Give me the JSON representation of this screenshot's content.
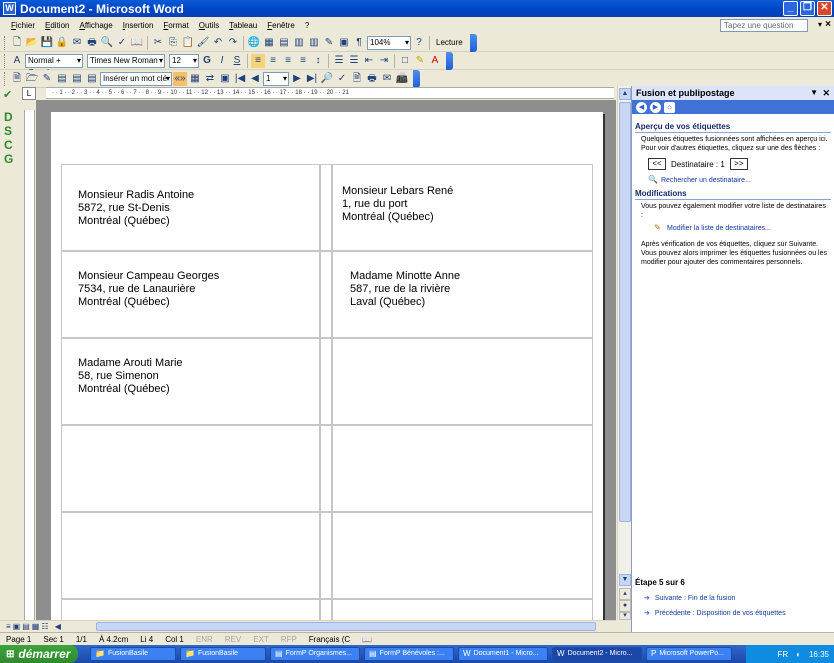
{
  "window": {
    "title": "Document2 - Microsoft Word",
    "minimize": "_",
    "maximize": "❐",
    "close": "✕"
  },
  "menu": {
    "items": [
      "Fichier",
      "Edition",
      "Affichage",
      "Insertion",
      "Format",
      "Outils",
      "Tableau",
      "Fenêtre",
      "?"
    ],
    "help_placeholder": "Tapez une question",
    "close": "×"
  },
  "toolbar_standard": {
    "zoom": "104%",
    "reading": "Lecture"
  },
  "toolbar_format": {
    "style": "Normal + Gauche :",
    "font": "Times New Roman",
    "size": "12",
    "bold": "G",
    "italic": "I",
    "underline": "S"
  },
  "toolbar_merge": {
    "insert_field": "Insérer un mot clé ▾",
    "record": "1"
  },
  "sidebar_letters": [
    "D",
    "S",
    "C",
    "G"
  ],
  "labels": [
    {
      "line1": "Monsieur Radis Antoine",
      "line2": "5872, rue St-Denis",
      "line3": "Montréal (Québec)"
    },
    {
      "line1": "Monsieur Lebars René",
      "line2": "1, rue du port",
      "line3": "Montréal (Québec)"
    },
    {
      "line1": "Monsieur Campeau Georges",
      "line2": "7534, rue de Lanaurière",
      "line3": "Montréal (Québec)"
    },
    {
      "line1": "Madame Minotte Anne",
      "line2": "587, rue de la rivière",
      "line3": "Laval (Québec)"
    },
    {
      "line1": "Madame Arouti Marie",
      "line2": "58, rue Simenon",
      "line3": "Montréal (Québec)"
    }
  ],
  "taskpane": {
    "title": "Fusion et publipostage",
    "section1_title": "Aperçu de vos étiquettes",
    "section1_text": "Quelques étiquettes fusionnées sont affichées en aperçu ici. Pour voir d'autres étiquettes, cliquez sur une des flèches :",
    "recipient_label": "Destinataire : 1",
    "prev_btn": "<<",
    "next_btn": ">>",
    "find_link": "Rechercher un destinataire...",
    "section2_title": "Modifications",
    "section2_text": "Vous pouvez également modifier votre liste de destinataires :",
    "edit_link": "Modifier la liste de destinataires...",
    "section3_text": "Après vérification de vos étiquettes, cliquez sur Suivante. Vous pouvez alors imprimer les étiquettes fusionnées ou les modifier pour ajouter des commentaires personnels.",
    "step": "Étape 5 sur 6",
    "next_step": "Suivante : Fin de la fusion",
    "prev_step": "Précédente : Disposition de vos étiquettes"
  },
  "status": {
    "page": "Page 1",
    "sec": "Sec 1",
    "pages": "1/1",
    "at": "À 4.2cm",
    "line": "Li 4",
    "col": "Col 1",
    "enr": "ENR",
    "rev": "REV",
    "ext": "EXT",
    "rfp": "RFP",
    "lang": "Français (C"
  },
  "taskbar": {
    "start": "démarrer",
    "tasks": [
      "FusionBasile",
      "FusionBasile",
      "FormP Organismes...",
      "FormP Bénévoles :...",
      "Document1 - Micro...",
      "Document2 - Micro...",
      "Microsoft PowerPo..."
    ],
    "lang": "FR",
    "clock": "16:35"
  }
}
